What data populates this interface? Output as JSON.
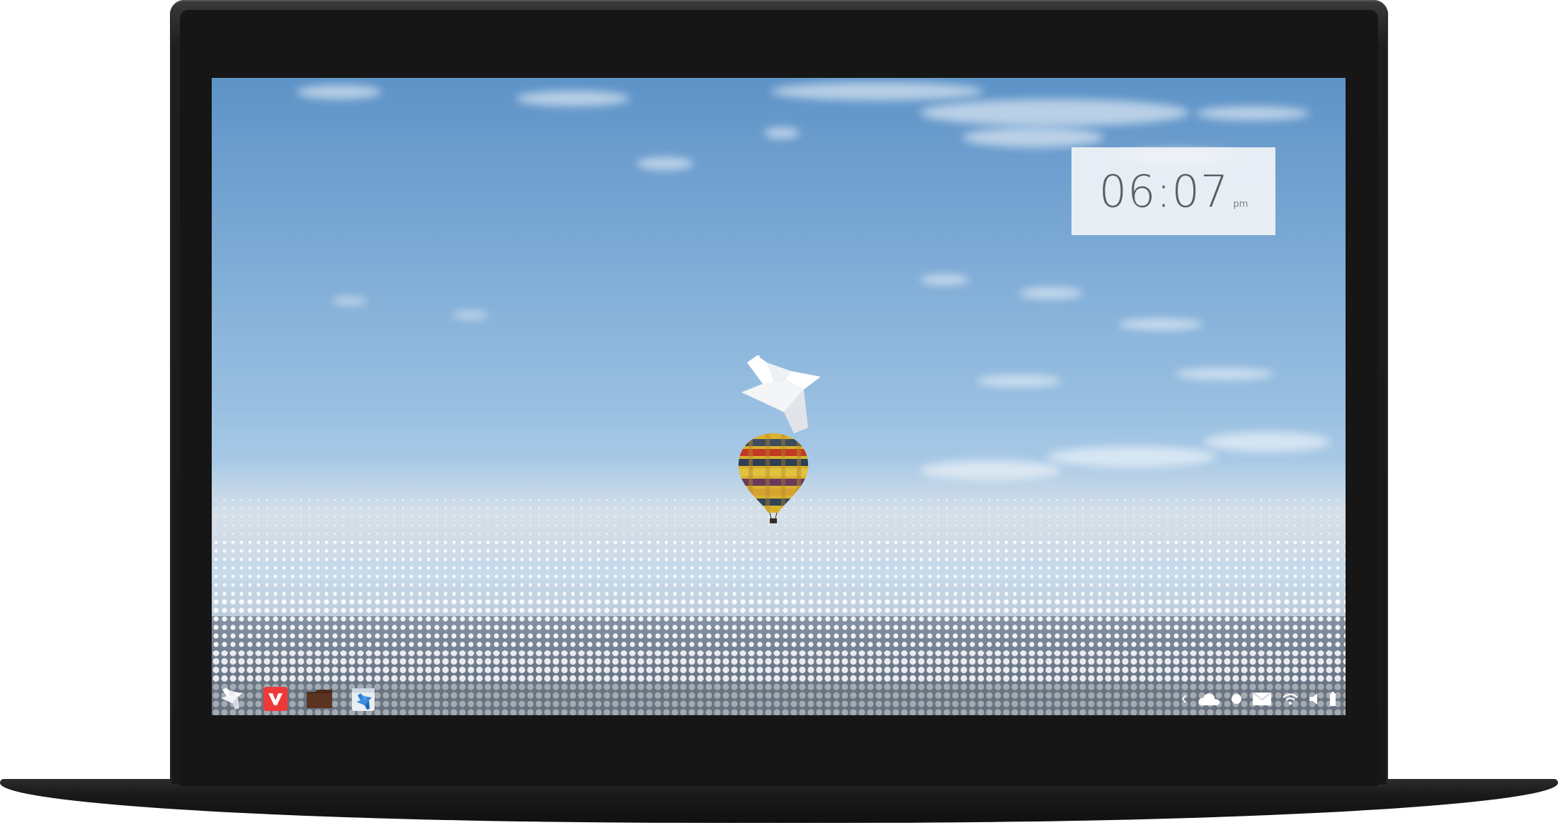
{
  "clock": {
    "time": "06:07",
    "ampm": "pm"
  },
  "taskbar": {
    "launchers": [
      {
        "icon": "origami-bird-menu-icon"
      },
      {
        "icon": "vivaldi-browser-icon",
        "color": "#ef3939"
      },
      {
        "icon": "folder-files-icon",
        "color": "#4a2a16"
      },
      {
        "icon": "app-store-bird-icon",
        "color": "#2e7fd8"
      }
    ],
    "tray": [
      {
        "icon": "chevron-left-icon"
      },
      {
        "icon": "cloud-icon"
      },
      {
        "icon": "circle-status-icon"
      },
      {
        "icon": "mail-icon"
      },
      {
        "icon": "wifi-icon"
      },
      {
        "icon": "volume-icon"
      },
      {
        "icon": "battery-icon"
      }
    ]
  },
  "colors": {
    "sky_top": "#5e93c7",
    "clock_bg": "#f0f3f6",
    "clock_text": "#5a5f66"
  }
}
